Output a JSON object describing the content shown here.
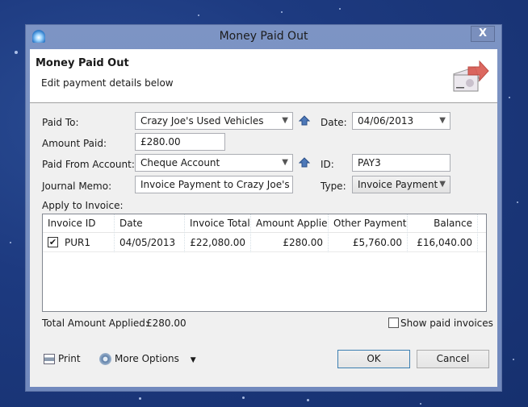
{
  "window": {
    "title": "Money Paid Out",
    "close_label": "X"
  },
  "header": {
    "title": "Money Paid Out",
    "subtitle": "Edit payment details below"
  },
  "form": {
    "paid_to": {
      "label": "Paid To:",
      "value": "Crazy Joe's Used Vehicles"
    },
    "amount_paid": {
      "label": "Amount Paid:",
      "value": "£280.00"
    },
    "paid_from_account": {
      "label": "Paid From Account:",
      "value": "Cheque Account"
    },
    "journal_memo": {
      "label": "Journal Memo:",
      "value": "Invoice Payment to Crazy Joe's Used Vehicles"
    },
    "date": {
      "label": "Date:",
      "value": "04/06/2013"
    },
    "id": {
      "label": "ID:",
      "value": "PAY3"
    },
    "type": {
      "label": "Type:",
      "value": "Invoice Payment"
    },
    "apply_to_invoice_label": "Apply to Invoice:"
  },
  "invoice_table": {
    "columns": [
      "Invoice ID",
      "Date",
      "Invoice Total",
      "Amount Applied",
      "Other Payments",
      "Balance"
    ],
    "rows": [
      {
        "checked": true,
        "invoice_id": "PUR1",
        "date": "04/05/2013",
        "invoice_total": "£22,080.00",
        "amount_applied": "£280.00",
        "other_payments": "£5,760.00",
        "balance": "£16,040.00"
      }
    ]
  },
  "footer": {
    "total_label": "Total Amount Applied:",
    "total_value": "£280.00",
    "show_paid_label": "Show paid invoices",
    "show_paid_checked": false,
    "print_label": "Print",
    "more_options_label": "More Options",
    "ok_label": "OK",
    "cancel_label": "Cancel"
  }
}
